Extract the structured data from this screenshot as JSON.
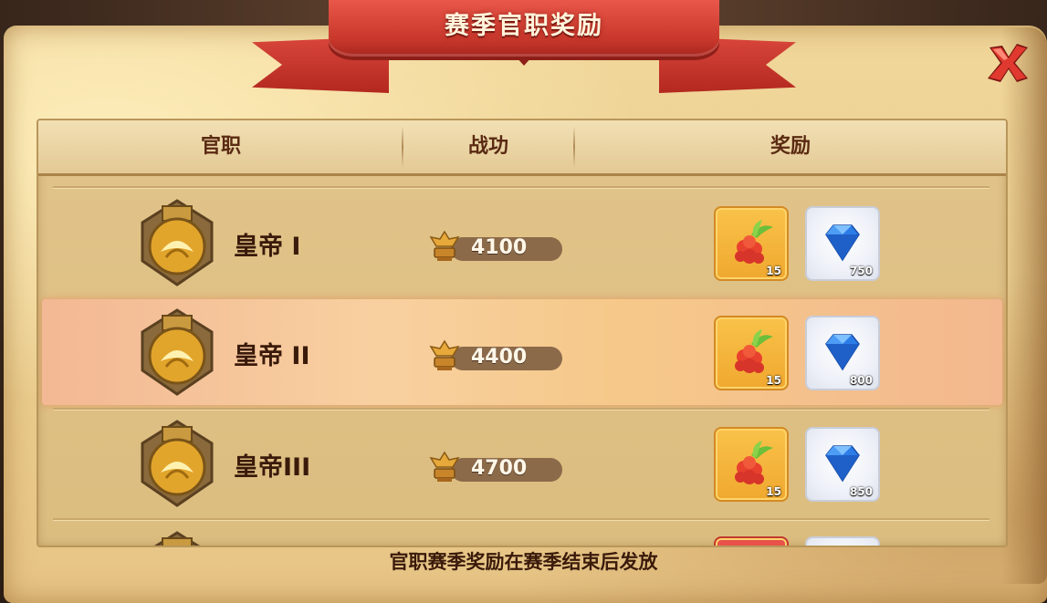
{
  "dialog": {
    "title": "赛季官职奖励",
    "footer_note": "官职赛季奖励在赛季结束后发放"
  },
  "table": {
    "headers": {
      "rank": "官职",
      "merit": "战功",
      "reward": "奖励"
    },
    "rows": [
      {
        "rank": "皇帝 I",
        "merit": "4100",
        "berry_count": "15",
        "gem_count": "750",
        "highlighted": false
      },
      {
        "rank": "皇帝 II",
        "merit": "4400",
        "berry_count": "15",
        "gem_count": "800",
        "highlighted": true
      },
      {
        "rank": "皇帝III",
        "merit": "4700",
        "berry_count": "15",
        "gem_count": "850",
        "highlighted": false
      }
    ]
  },
  "icons": {
    "close": "close-x-icon",
    "rank_badge": "emperor-badge-icon",
    "merit": "eagle-spqr-icon",
    "berry": "raspberry-icon",
    "gem": "blue-diamond-icon"
  },
  "colors": {
    "ribbon": "#c8372b",
    "parchment": "#ecd092",
    "header_text": "#5a2a12",
    "highlight": "#f8d0a0",
    "merit_pill": "#8b6a4a",
    "close": "#d8302a"
  }
}
